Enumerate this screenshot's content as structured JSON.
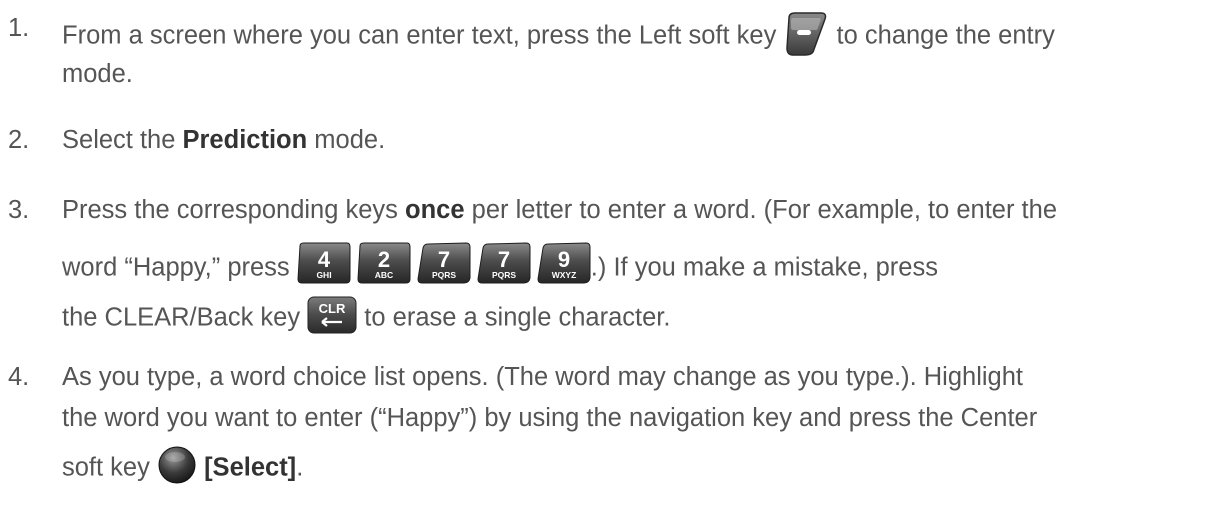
{
  "steps": [
    {
      "num": "1.",
      "l1_a": "From a screen where you can enter text, press the Left soft key",
      "l1_b": "to change the entry",
      "l2": "mode.",
      "icon": "left-soft-key-icon"
    },
    {
      "num": "2.",
      "a": "Select the",
      "bold": "Prediction",
      "b": "mode."
    },
    {
      "num": "3.",
      "l1_a": "Press the corresponding keys",
      "l1_bold": "once",
      "l1_b": "per letter to enter a word. (For example, to enter the",
      "l2_a": "word “Happy,” press",
      "l2_b": ".) If you make a mistake, press",
      "l3_a": "the CLEAR/Back key",
      "l3_b": "to erase a single character.",
      "keys": [
        {
          "digit": "4",
          "letters": "GHI",
          "icon": "key-4-ghi-icon"
        },
        {
          "digit": "2",
          "letters": "ABC",
          "icon": "key-2-abc-icon"
        },
        {
          "digit": "7",
          "letters": "PQRS",
          "icon": "key-7-pqrs-icon"
        },
        {
          "digit": "7",
          "letters": "PQRS",
          "icon": "key-7-pqrs-icon"
        },
        {
          "digit": "9",
          "letters": "WXYZ",
          "icon": "key-9-wxyz-icon"
        }
      ],
      "clear_key": {
        "label": "CLR",
        "icon": "clear-back-key-icon"
      }
    },
    {
      "num": "4.",
      "l1": "As you type, a word choice list opens. (The word may change as you type.). Highlight",
      "l2": "the word you want to enter (“Happy”) by using the navigation key and press the Center",
      "l3_a": "soft key",
      "l3_bold": "[Select]",
      "l3_b": ".",
      "icon": "center-soft-key-icon"
    }
  ],
  "colors": {
    "text": "#555555",
    "bold": "#333333",
    "key_dark": "#2b2b2b",
    "key_light": "#7a7a7a"
  }
}
